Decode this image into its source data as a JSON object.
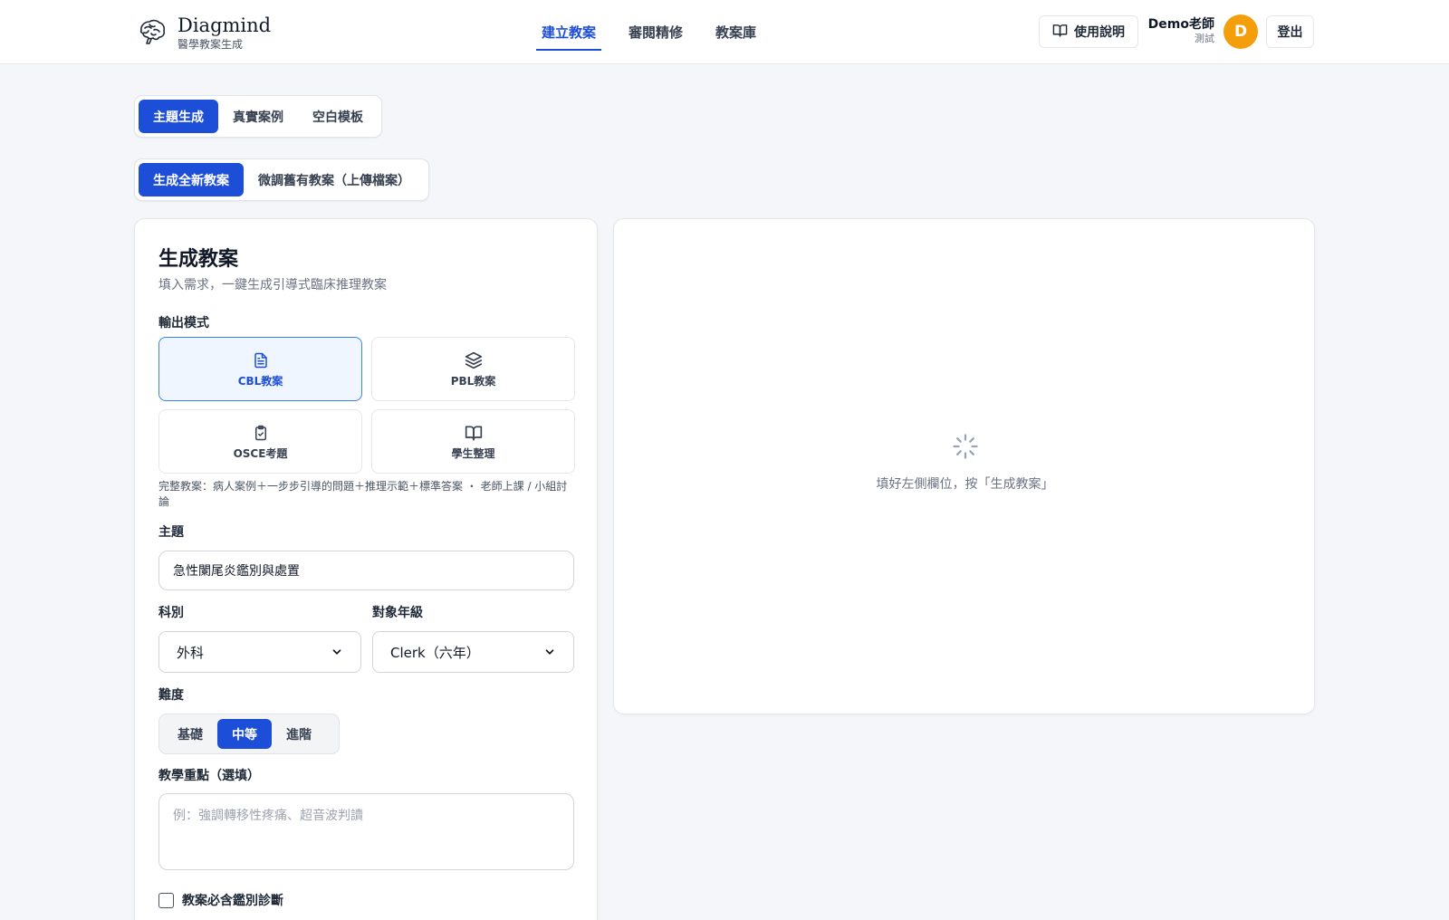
{
  "brand": {
    "name": "Diagmind",
    "subtitle": "醫學教案生成",
    "logo_icon": "brain-icon"
  },
  "nav": {
    "items": [
      {
        "label": "建立教案",
        "active": true
      },
      {
        "label": "審閱精修",
        "active": false
      },
      {
        "label": "教案庫",
        "active": false
      }
    ]
  },
  "header": {
    "help_label": "使用說明",
    "help_icon": "book-open-icon",
    "user_name": "Demo老師",
    "user_role": "測試",
    "avatar_initial": "D",
    "avatar_color": "#f59e0b",
    "logout_label": "登出"
  },
  "source_tabs": [
    {
      "label": "主題生成",
      "active": true
    },
    {
      "label": "真實案例",
      "active": false
    },
    {
      "label": "空白模板",
      "active": false
    }
  ],
  "action_tabs": [
    {
      "label": "生成全新教案",
      "active": true
    },
    {
      "label": "微調舊有教案（上傳檔案）",
      "active": false
    }
  ],
  "form": {
    "title": "生成教案",
    "subtitle": "填入需求，一鍵生成引導式臨床推理教案",
    "output_mode_label": "輸出模式",
    "modes": [
      {
        "label": "CBL教案",
        "icon": "file-text-icon",
        "selected": true
      },
      {
        "label": "PBL教案",
        "icon": "layers-icon",
        "selected": false
      },
      {
        "label": "OSCE考題",
        "icon": "clipboard-check-icon",
        "selected": false
      },
      {
        "label": "學生整理",
        "icon": "book-open-icon",
        "selected": false
      }
    ],
    "mode_description": "完整教案：病人案例＋一步步引導的問題＋推理示範＋標準答案 ・ 老師上課 / 小組討論",
    "topic_label": "主題",
    "topic_value": "急性闌尾炎鑑別與處置",
    "department_label": "科別",
    "department_value": "外科",
    "grade_label": "對象年級",
    "grade_value": "Clerk（六年）",
    "difficulty_label": "難度",
    "difficulty_options": [
      {
        "label": "基礎",
        "active": false
      },
      {
        "label": "中等",
        "active": true
      },
      {
        "label": "進階",
        "active": false
      }
    ],
    "focus_label": "教學重點（選填）",
    "focus_placeholder": "例：強調轉移性疼痛、超音波判讀",
    "include_ddx_label": "教案必含鑑別診斷",
    "include_ddx_checked": false
  },
  "preview": {
    "empty_message": "填好左側欄位，按「生成教案」",
    "icon": "loader-icon"
  },
  "colors": {
    "accent": "#1d4ed8",
    "accent_light_bg": "#eff6ff",
    "page_bg": "#f4f6f9"
  }
}
